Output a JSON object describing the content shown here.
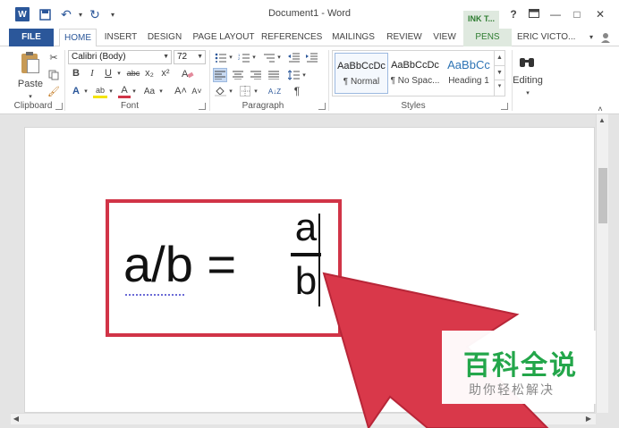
{
  "window": {
    "title": "Document1 - Word",
    "ink_tab": "INK T...",
    "help": "?",
    "minimize": "—",
    "maximize": "□",
    "close": "✕"
  },
  "quick_access": {
    "word_logo": "W",
    "save": "💾",
    "undo": "↶",
    "redo": "↻",
    "customize": "▾"
  },
  "tabs": {
    "file": "FILE",
    "home": "HOME",
    "insert": "INSERT",
    "design": "DESIGN",
    "page_layout": "PAGE LAYOUT",
    "references": "REFERENCES",
    "mailings": "MAILINGS",
    "review": "REVIEW",
    "view": "VIEW",
    "pens": "PENS",
    "user": "ERIC VICTO..."
  },
  "clipboard": {
    "paste_label": "Paste",
    "group_label": "Clipboard"
  },
  "font": {
    "name": "Calibri (Body)",
    "size": "72",
    "bold": "B",
    "italic": "I",
    "underline": "U",
    "strike": "abc",
    "subscript": "x₂",
    "superscript": "x²",
    "grow": "A˄",
    "shrink": "A˅",
    "case": "Aa",
    "text_effects": "A",
    "highlight": "ab",
    "font_color": "A",
    "group_label": "Font"
  },
  "paragraph": {
    "group_label": "Paragraph",
    "pilcrow": "¶",
    "sort": "A↓Z"
  },
  "styles": {
    "group_label": "Styles",
    "items": [
      {
        "sample": "AaBbCcDc",
        "name": "¶ Normal"
      },
      {
        "sample": "AaBbCcDc",
        "name": "¶ No Spac..."
      },
      {
        "sample": "AaBbCc",
        "name": "Heading 1"
      }
    ]
  },
  "editing": {
    "label": "Editing"
  },
  "document": {
    "equation_left": "a/b =",
    "numerator": "a",
    "denominator": "b"
  },
  "watermark": {
    "main": "百科全说",
    "sub": "助你轻松解决"
  },
  "colors": {
    "word_blue": "#2b579a",
    "ink_green": "#2f7d32",
    "box_red": "#d13447",
    "arrow_red": "#d9384a",
    "watermark_green": "#23a64a"
  }
}
